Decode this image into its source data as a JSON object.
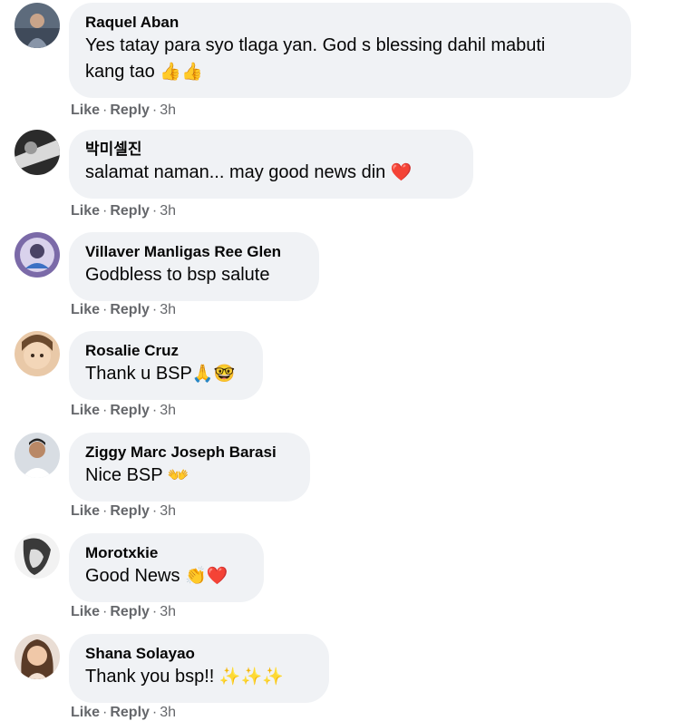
{
  "comments": [
    {
      "author": "Raquel Aban",
      "text_line1": "Yes tatay para syo tlaga yan. God s blessing dahil mabuti",
      "text_line2": "kang tao",
      "emoji": "👍👍",
      "like": "Like",
      "reply": "Reply",
      "dot": "·",
      "time": "3h"
    },
    {
      "author": "박미셀진",
      "text": "salamat naman... may good news din",
      "emoji": "❤️",
      "like": "Like",
      "reply": "Reply",
      "dot": "·",
      "time": "3h"
    },
    {
      "author": "Villaver Manligas Ree Glen",
      "text": "Godbless to bsp salute",
      "emoji": "",
      "like": "Like",
      "reply": "Reply",
      "dot": "·",
      "time": "3h"
    },
    {
      "author": "Rosalie Cruz",
      "text": "Thank u BSP",
      "emoji": "🙏🤓",
      "like": "Like",
      "reply": "Reply",
      "dot": "·",
      "time": "3h"
    },
    {
      "author": "Ziggy Marc Joseph Barasi",
      "text": "Nice BSP",
      "emoji": "👐",
      "like": "Like",
      "reply": "Reply",
      "dot": "·",
      "time": "3h"
    },
    {
      "author": "Morotxkie",
      "text": "Good News",
      "emoji": "👏❤️",
      "like": "Like",
      "reply": "Reply",
      "dot": "·",
      "time": "3h"
    },
    {
      "author": "Shana Solayao",
      "text": "Thank you bsp!!",
      "emoji": "✨✨✨",
      "like": "Like",
      "reply": "Reply",
      "dot": "·",
      "time": "3h"
    }
  ],
  "colors": {
    "bubble": "#f0f2f5",
    "meta_text": "#65676b",
    "heart": "#e41e3f",
    "thumbs": "#f7b928",
    "sparkle": "#f5c518"
  }
}
